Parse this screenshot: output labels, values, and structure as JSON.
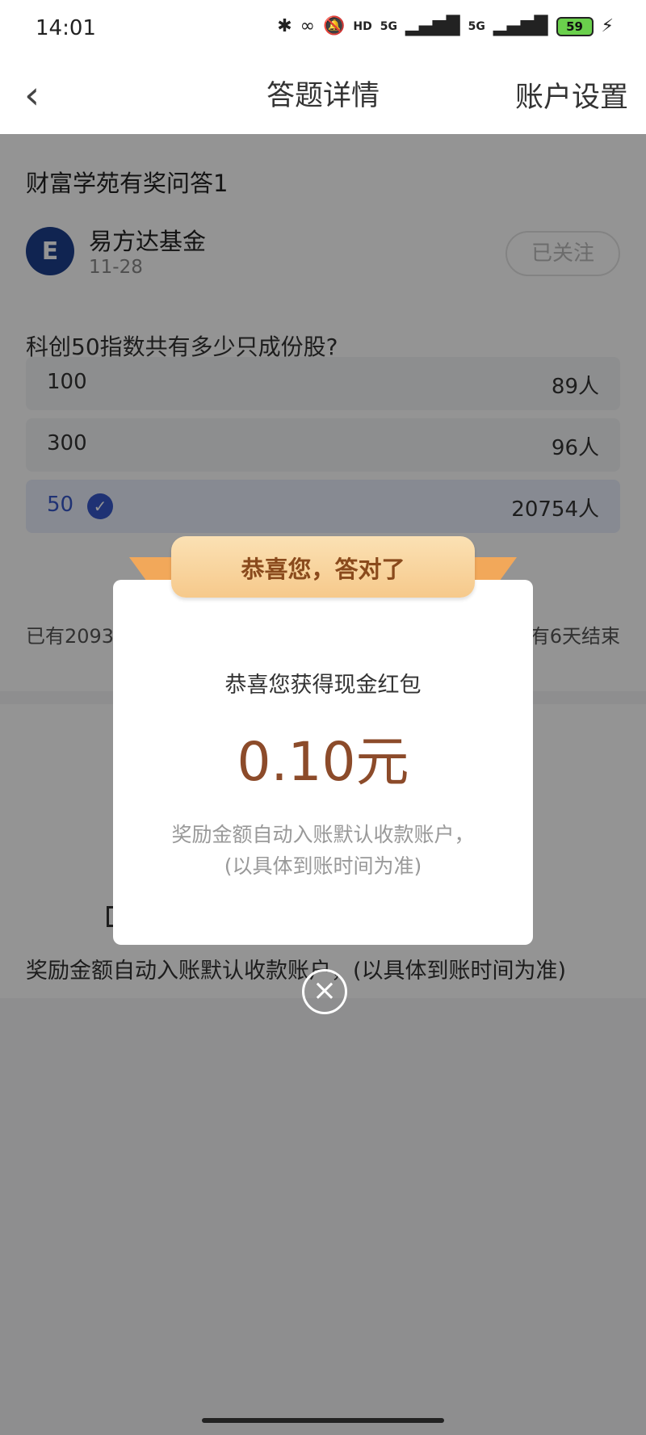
{
  "status_bar": {
    "time": "14:01",
    "battery": "59",
    "network1": "5G",
    "network2": "5G",
    "hd_label": "HD"
  },
  "header": {
    "back_icon": "chevron-left-icon",
    "title": "答题详情",
    "account_settings": "账户设置"
  },
  "question_card": {
    "title": "财富学苑有奖问答1",
    "org_name": "易方达基金",
    "date": "11-28",
    "follow_label": "已关注",
    "question": "科创50指数共有多少只成份股?",
    "options": [
      {
        "label": "100",
        "count": "89人"
      },
      {
        "label": "300",
        "count": "96人"
      },
      {
        "label": "50",
        "count": "20754人",
        "correct": true
      }
    ],
    "stats_left": "已有2093",
    "stats_right": "有6天结束"
  },
  "background_note": "奖励金额自动入账默认收款账户，(以具体到账时间为准)",
  "modal": {
    "ribbon_text": "恭喜您，答对了",
    "subtitle": "恭喜您获得现金红包",
    "amount": "0.10元",
    "note_line1": "奖励金额自动入账默认收款账户，",
    "note_line2": "(以具体到账时间为准)"
  },
  "colors": {
    "accent_blue": "#3657c9",
    "amount_brown": "#8c4b2a",
    "ribbon_orange": "#f6c98b"
  }
}
